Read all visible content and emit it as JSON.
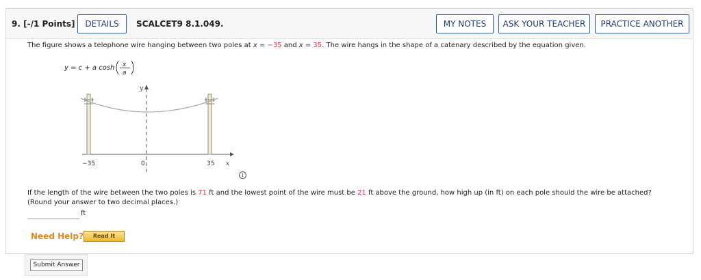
{
  "header": {
    "question_number": "9.",
    "points": "[-/1 Points]",
    "details_label": "DETAILS",
    "question_id": "SCALCET9 8.1.049.",
    "my_notes_label": "MY NOTES",
    "ask_teacher_label": "ASK YOUR TEACHER",
    "practice_another_label": "PRACTICE ANOTHER"
  },
  "statement": {
    "part1": "The figure shows a telephone wire hanging between two poles at ",
    "x_eq_1": "x = ",
    "x_val_1": "−35",
    "and": " and ",
    "x_eq_2": "x = ",
    "x_val_2": "35",
    "part2": ". The wire hangs in the shape of a catenary described by the equation given."
  },
  "equation": {
    "lhs": "y = c + a cosh",
    "num": "x",
    "den": "a"
  },
  "figure": {
    "y_axis_label": "y",
    "x_axis_label": "x",
    "tick_left": "−35",
    "tick_origin": "0",
    "tick_right": "35",
    "info_glyph": "i"
  },
  "question": {
    "part1": "If the length of the wire between the two poles is ",
    "length": "71",
    "part2": " ft and the lowest point of the wire must be ",
    "height": "21",
    "part3": " ft above the ground, how high up (in ft) on each pole should the wire be attached? (Round your answer to two decimal places.)"
  },
  "answer": {
    "value": "",
    "placeholder": "",
    "unit": "ft"
  },
  "help": {
    "label": "Need Help?",
    "read_it_label": "Read It"
  },
  "submit": {
    "label": "Submit Answer"
  },
  "colors": {
    "accent": "#2c5aa0",
    "highlight": "#d6372b",
    "help": "#e08a1f"
  }
}
